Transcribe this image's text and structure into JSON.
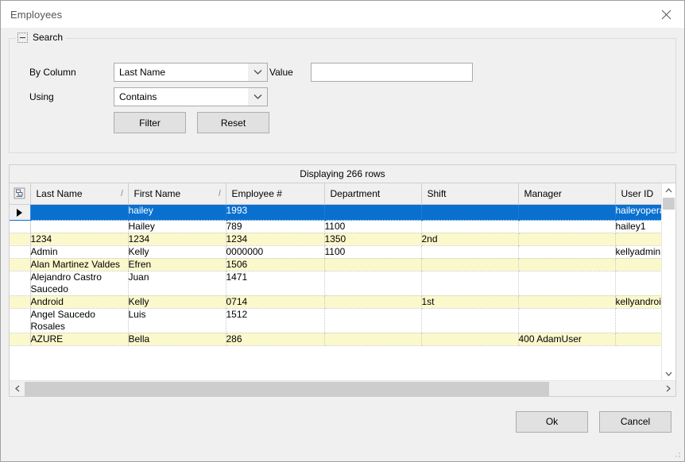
{
  "window": {
    "title": "Employees",
    "close_icon": "close-icon"
  },
  "search": {
    "group_title": "Search",
    "by_column_label": "By Column",
    "by_column_value": "Last Name",
    "using_label": "Using",
    "using_value": "Contains",
    "value_label": "Value",
    "value_text": "",
    "value_placeholder": "",
    "filter_label": "Filter",
    "reset_label": "Reset"
  },
  "grid": {
    "caption": "Displaying 266 rows",
    "columns": [
      {
        "label": "Last Name",
        "sortable": true
      },
      {
        "label": "First Name",
        "sortable": true
      },
      {
        "label": "Employee #",
        "sortable": false
      },
      {
        "label": "Department",
        "sortable": false
      },
      {
        "label": "Shift",
        "sortable": false
      },
      {
        "label": "Manager",
        "sortable": false
      },
      {
        "label": "User ID",
        "sortable": false
      }
    ],
    "sort_glyph": "/",
    "rows": [
      {
        "selected": true,
        "current": true,
        "last_name": "",
        "first_name": "hailey",
        "employee_no": "1993",
        "department": "",
        "shift": "",
        "manager": "",
        "user_id": "haileyopera"
      },
      {
        "selected": false,
        "current": false,
        "last_name": "",
        "first_name": "Hailey",
        "employee_no": "789",
        "department": "1100",
        "shift": "",
        "manager": "",
        "user_id": "hailey1"
      },
      {
        "selected": false,
        "current": false,
        "last_name": "1234",
        "first_name": "1234",
        "employee_no": "1234",
        "department": "1350",
        "shift": "2nd",
        "manager": "",
        "user_id": ""
      },
      {
        "selected": false,
        "current": false,
        "last_name": "Admin",
        "first_name": "Kelly",
        "employee_no": "0000000",
        "department": "1100",
        "shift": "",
        "manager": "",
        "user_id": "kellyadmin"
      },
      {
        "selected": false,
        "current": false,
        "last_name": "Alan Martinez Valdes",
        "first_name": "Efren",
        "employee_no": "1506",
        "department": "",
        "shift": "",
        "manager": "",
        "user_id": ""
      },
      {
        "selected": false,
        "current": false,
        "last_name": "Alejandro Castro Saucedo",
        "first_name": "Juan",
        "employee_no": "1471",
        "department": "",
        "shift": "",
        "manager": "",
        "user_id": ""
      },
      {
        "selected": false,
        "current": false,
        "last_name": "Android",
        "first_name": "Kelly",
        "employee_no": "0714",
        "department": "",
        "shift": "1st",
        "manager": "",
        "user_id": "kellyandroi"
      },
      {
        "selected": false,
        "current": false,
        "last_name": "Angel Saucedo Rosales",
        "first_name": "Luis",
        "employee_no": "1512",
        "department": "",
        "shift": "",
        "manager": "",
        "user_id": ""
      },
      {
        "selected": false,
        "current": false,
        "last_name": "AZURE",
        "first_name": "Bella",
        "employee_no": "286",
        "department": "",
        "shift": "",
        "manager": "400 AdamUser",
        "user_id": ""
      }
    ]
  },
  "footer": {
    "ok_label": "Ok",
    "cancel_label": "Cancel"
  },
  "colors": {
    "selection": "#0a70d0",
    "alt_row": "#fbf8cc",
    "window_bg": "#f0f0f0"
  }
}
